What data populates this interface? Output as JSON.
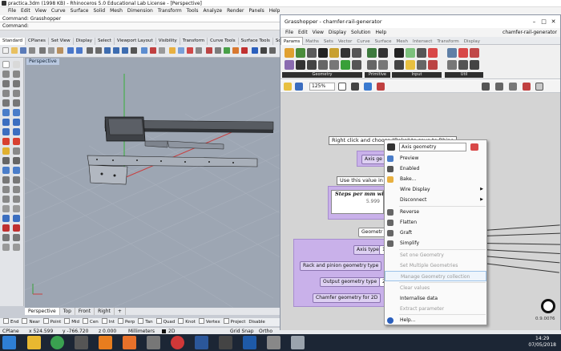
{
  "rhino": {
    "title": "practica.3dm (1998 KB) - Rhinoceros 5.0 Educational Lab License - [Perspective]",
    "menu": [
      "File",
      "Edit",
      "View",
      "Curve",
      "Surface",
      "Solid",
      "Mesh",
      "Dimension",
      "Transform",
      "Tools",
      "Analyze",
      "Render",
      "Panels",
      "Help"
    ],
    "command_history": "Command: Grasshopper",
    "command_prompt": "Command:",
    "toolbar_tabs": [
      "Standard",
      "CPlanes",
      "Set View",
      "Display",
      "Select",
      "Viewport Layout",
      "Visibility",
      "Transform",
      "Curve Tools",
      "Surface Tools",
      "Solid Tools"
    ],
    "viewport_label": "Perspective",
    "viewport_tabs": [
      "Perspective",
      "Top",
      "Front",
      "Right"
    ],
    "viewport_add": "+",
    "osnaps": [
      "End",
      "Near",
      "Point",
      "Mid",
      "Cen",
      "Int",
      "Perp",
      "Tan",
      "Quad",
      "Knot",
      "Vertex",
      "Project",
      "Disable"
    ],
    "status": {
      "cplane": "CPlane",
      "x": "x 524.599",
      "y": "y -766.720",
      "z": "z 0.000",
      "units": "Millimeters",
      "layer": "2D",
      "grid_snap": "Grid Snap",
      "ortho": "Ortho"
    }
  },
  "grasshopper": {
    "title": "Grasshopper - chamfer-rail-generator",
    "menu": [
      "File",
      "Edit",
      "View",
      "Display",
      "Solution",
      "Help"
    ],
    "doc_name": "chamfer-rail-generator",
    "tabs": [
      "Params",
      "Maths",
      "Sets",
      "Vector",
      "Curve",
      "Surface",
      "Mesh",
      "Intersect",
      "Transform",
      "Display"
    ],
    "ribbon_groups": [
      "Geometry",
      "Primitive",
      "Input",
      "Util"
    ],
    "zoom": "125%",
    "canvas": {
      "hint_panel": "Right click and choose \"Bake\" to save to Rhino",
      "axis_geometry_component": "Axis ge",
      "use_value_panel": "Use this value in yo",
      "steps_slider_label": "Steps per mm wit",
      "steps_slider_value": "5.999",
      "geometry_group": "Geometr",
      "params": [
        "Axis type",
        "Rack and pinion geometry type",
        "Output geometry type",
        "Chamfer geometry for 2D"
      ],
      "param_values": [
        "1",
        "",
        "2",
        ""
      ]
    },
    "version": "0.9.0076"
  },
  "context_menu": {
    "name_field": "Axis geometry",
    "items": [
      {
        "label": "Preview",
        "icon": "preview-icon",
        "enabled": true,
        "submenu": false
      },
      {
        "label": "Enabled",
        "icon": "enabled-icon",
        "enabled": true,
        "submenu": false
      },
      {
        "label": "Bake...",
        "icon": "bake-icon",
        "enabled": true,
        "submenu": false
      },
      {
        "label": "Wire Display",
        "icon": "",
        "enabled": true,
        "submenu": true
      },
      {
        "label": "Disconnect",
        "icon": "",
        "enabled": true,
        "submenu": true
      },
      {
        "label": "Reverse",
        "icon": "reverse-icon",
        "enabled": true,
        "submenu": false
      },
      {
        "label": "Flatten",
        "icon": "flatten-icon",
        "enabled": true,
        "submenu": false
      },
      {
        "label": "Graft",
        "icon": "graft-icon",
        "enabled": true,
        "submenu": false
      },
      {
        "label": "Simplify",
        "icon": "simplify-icon",
        "enabled": true,
        "submenu": false
      },
      {
        "label": "Set one Geometry",
        "icon": "",
        "enabled": false,
        "submenu": false
      },
      {
        "label": "Set Multiple Geometries",
        "icon": "",
        "enabled": false,
        "submenu": false
      },
      {
        "label": "Manage Geometry collection",
        "icon": "",
        "enabled": false,
        "submenu": false
      },
      {
        "label": "Clear values",
        "icon": "",
        "enabled": false,
        "submenu": false
      },
      {
        "label": "Internalise data",
        "icon": "",
        "enabled": true,
        "submenu": false
      },
      {
        "label": "Extract parameter",
        "icon": "",
        "enabled": false,
        "submenu": false
      },
      {
        "label": "Help...",
        "icon": "help-icon",
        "enabled": true,
        "submenu": false
      }
    ]
  },
  "taskbar": {
    "time": "14:29",
    "date": "07/05/2018"
  }
}
